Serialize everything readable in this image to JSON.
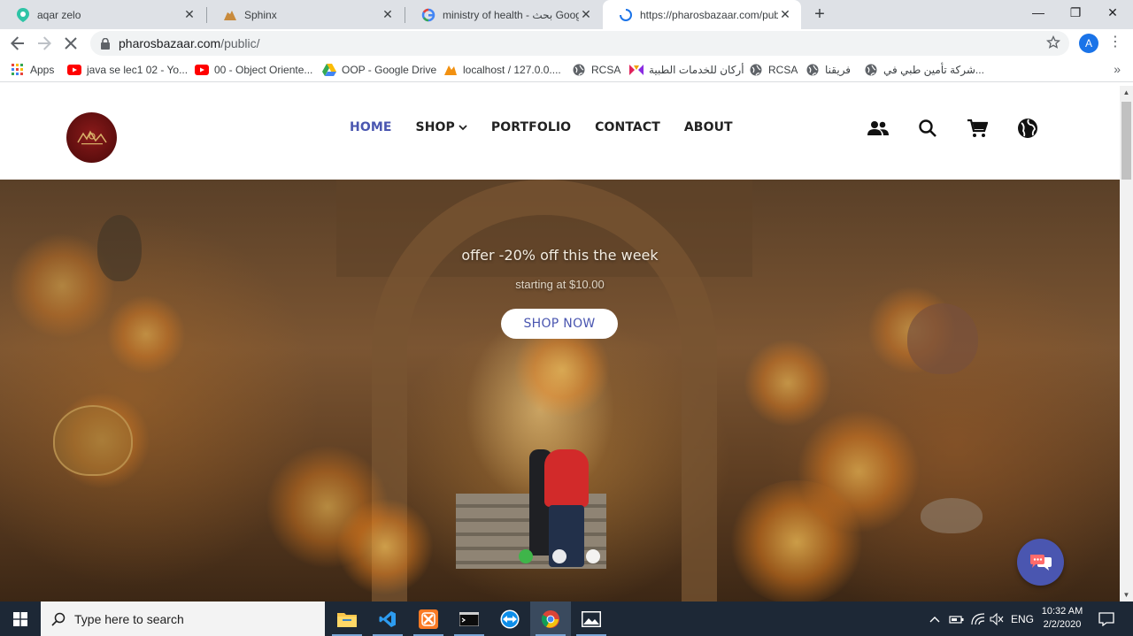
{
  "browser": {
    "tabs": [
      {
        "title": "aqar zelo",
        "icon": "map-pin-icon",
        "color": "#2ec4a6"
      },
      {
        "title": "Sphinx",
        "icon": "sphinx-icon",
        "color": "#c88a3c"
      },
      {
        "title": "ministry of health - بحث Google",
        "icon": "google-icon"
      },
      {
        "title": "https://pharosbazaar.com/public/",
        "icon": "loading-spinner-icon",
        "active": true
      }
    ],
    "new_tab_label": "+",
    "window_controls": {
      "minimize": "—",
      "restore": "❐",
      "close": "✕"
    },
    "url_host": "pharosbazaar.com",
    "url_path": "/public/",
    "profile_initial": "A",
    "bookmarks": [
      {
        "label": "Apps",
        "icon": "apps-grid-icon"
      },
      {
        "label": "java se lec1 02 - Yo...",
        "icon": "youtube-icon"
      },
      {
        "label": "00 - Object Oriente...",
        "icon": "youtube-icon"
      },
      {
        "label": "OOP - Google Drive",
        "icon": "google-drive-icon"
      },
      {
        "label": "localhost / 127.0.0....",
        "icon": "phpmyadmin-icon"
      },
      {
        "label": "RCSA",
        "icon": "globe-icon"
      },
      {
        "label": "أركان للخدمات الطبية",
        "icon": "arkan-icon"
      },
      {
        "label": "RCSA",
        "icon": "globe-icon"
      },
      {
        "label": "فريقنا",
        "icon": "globe-icon"
      },
      {
        "label": "شركة تأمين طبي في...",
        "icon": "globe-icon"
      }
    ],
    "bookmarks_more": "»"
  },
  "site": {
    "nav": [
      {
        "label": "HOME",
        "active": true
      },
      {
        "label": "SHOP",
        "has_dropdown": true
      },
      {
        "label": "PORTFOLIO"
      },
      {
        "label": "CONTACT"
      },
      {
        "label": "ABOUT"
      }
    ],
    "header_icons": [
      "account-group-icon",
      "search-icon",
      "cart-icon",
      "globe-icon"
    ],
    "hero": {
      "title": "offer -20% off this the week",
      "subtitle": "starting at $10.00",
      "cta": "SHOP NOW",
      "slides": 3,
      "active_slide": 1
    },
    "accent_color": "#4a56b0",
    "active_dot_color": "#3fb54a"
  },
  "taskbar": {
    "search_placeholder": "Type here to search",
    "apps": [
      "file-explorer-icon",
      "vscode-icon",
      "xampp-icon",
      "terminal-icon",
      "teamviewer-icon",
      "chrome-icon",
      "photos-icon"
    ],
    "language": "ENG",
    "time": "10:32 AM",
    "date": "2/2/2020"
  }
}
